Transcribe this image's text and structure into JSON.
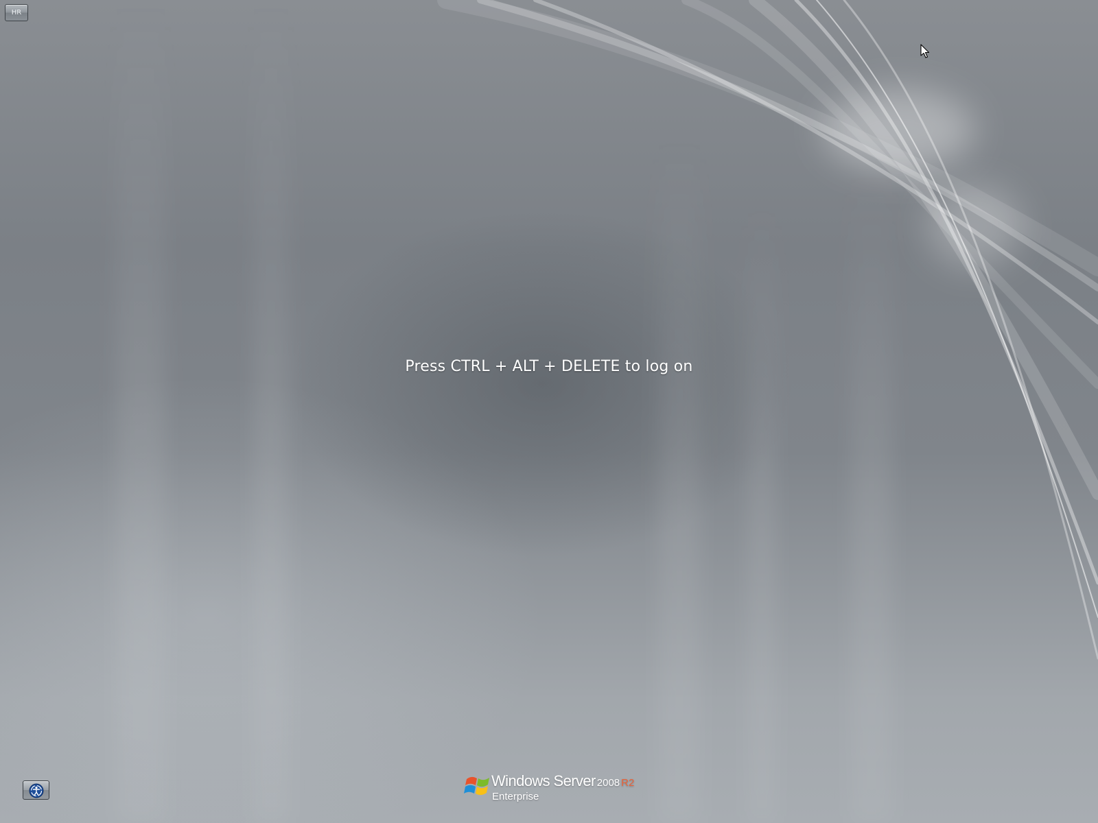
{
  "screen": {
    "type": "logon-screen",
    "prompt": "Press CTRL + ALT + DELETE to log on"
  },
  "top_left": {
    "language_label": "HR"
  },
  "bottom_left": {
    "ease_of_access_icon": "ease-of-access-icon"
  },
  "branding": {
    "product": "Windows Server",
    "version": "2008",
    "release": "R2",
    "edition": "Enterprise",
    "logo_icon": "windows-flag-icon",
    "release_color": "#e8633a"
  },
  "colors": {
    "background": "#80858b",
    "text": "#ffffff"
  }
}
